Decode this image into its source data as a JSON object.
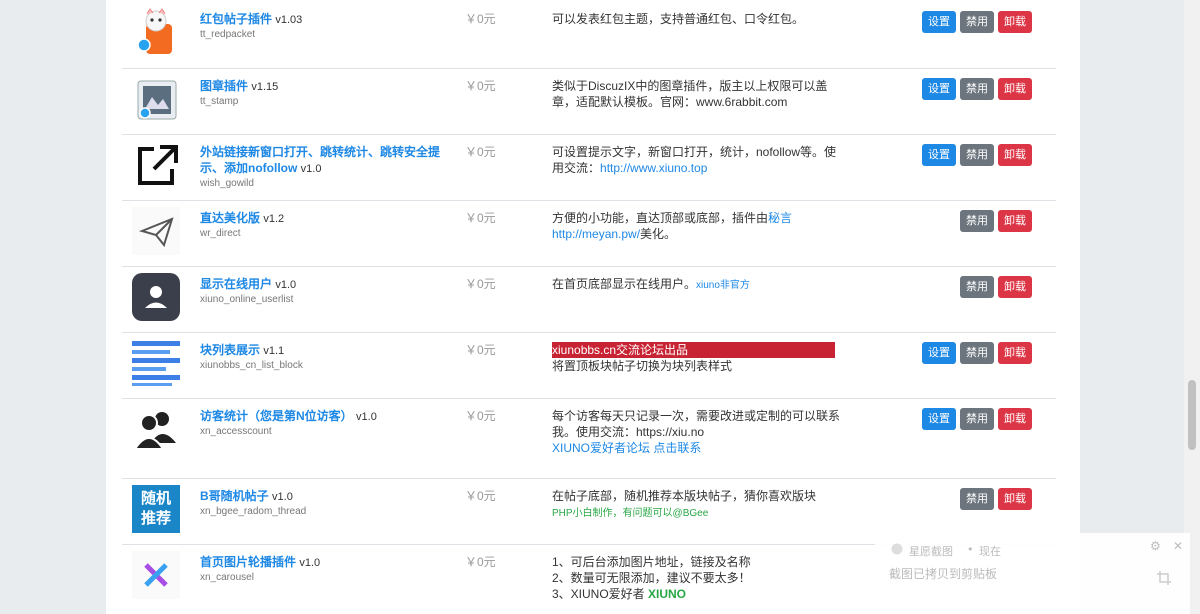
{
  "plugins": [
    {
      "name": "红包帖子插件",
      "version": "v1.03",
      "id": "tt_redpacket",
      "price": "￥0元",
      "desc": [
        {
          "t": "可以发表红包主题，支持普通红包、口令红包。"
        }
      ],
      "buttons": [
        "设置",
        "禁用",
        "卸载"
      ]
    },
    {
      "name": "图章插件",
      "version": "v1.15",
      "id": "tt_stamp",
      "price": "￥0元",
      "desc": [
        {
          "t": "类似于DiscuzIX中的图章插件，版主以上权限可以盖章，适配默认模板。官网：www.6rabbit.com"
        }
      ],
      "buttons": [
        "设置",
        "禁用",
        "卸载"
      ]
    },
    {
      "name": "外站链接新窗口打开、跳转统计、跳转安全提示、添加nofollow",
      "version": "v1.0",
      "id": "wish_gowild",
      "price": "￥0元",
      "desc": [
        {
          "t": "可设置提示文字，新窗口打开，统计，nofollow等。使用交流："
        },
        {
          "t": "http://www.xiuno.top",
          "c": "link"
        }
      ],
      "buttons": [
        "设置",
        "禁用",
        "卸载"
      ]
    },
    {
      "name": "直达美化版",
      "version": "v1.2",
      "id": "wr_direct",
      "price": "￥0元",
      "desc": [
        {
          "t": "方便的小功能，直达顶部或底部，插件由"
        },
        {
          "t": "秘言",
          "c": "link"
        },
        {
          "t": " "
        },
        {
          "t": "http://meyan.pw/",
          "c": "link"
        },
        {
          "t": "美化。"
        }
      ],
      "buttons": [
        "禁用",
        "卸载"
      ]
    },
    {
      "name": "显示在线用户",
      "version": "v1.0",
      "id": "xiuno_online_userlist",
      "price": "￥0元",
      "desc": [
        {
          "t": "在首页底部显示在线用户。"
        },
        {
          "t": "xiuno非官方",
          "c": "small-blue"
        }
      ],
      "buttons": [
        "禁用",
        "卸载"
      ]
    },
    {
      "name": "块列表展示",
      "version": "v1.1",
      "id": "xiunobbs_cn_list_block",
      "price": "￥0元",
      "desc": [
        {
          "t": "xiunobbs.cn交流论坛出品",
          "c": "highlight"
        },
        {
          "t": "将置顶板块帖子切换为块列表样式"
        }
      ],
      "buttons": [
        "设置",
        "禁用",
        "卸载"
      ]
    },
    {
      "name": "访客统计（您是第N位访客）",
      "version": "v1.0",
      "id": "xn_accesscount",
      "price": "￥0元",
      "desc": [
        {
          "t": "每个访客每天只记录一次，需要改进或定制的可以联系我。使用交流：https://xiu.no"
        },
        {
          "t": "\n"
        },
        {
          "t": "XIUNO爱好者论坛  点击联系",
          "c": "link"
        }
      ],
      "buttons": [
        "设置",
        "禁用",
        "卸载"
      ]
    },
    {
      "name": "B哥随机帖子",
      "version": "v1.0",
      "id": "xn_bgee_radom_thread",
      "price": "￥0元",
      "desc": [
        {
          "t": "在帖子底部，随机推荐本版块帖子，猜你喜欢版块"
        },
        {
          "t": "\n"
        },
        {
          "t": "PHP小白制作，有问题可以@BGee",
          "c": "green"
        }
      ],
      "buttons": [
        "禁用",
        "卸载"
      ]
    },
    {
      "name": "首页图片轮播插件",
      "version": "v1.0",
      "id": "xn_carousel",
      "price": "￥0元",
      "desc": [
        {
          "t": "1、可后台添加图片地址，链接及名称"
        },
        {
          "t": "\n"
        },
        {
          "t": "2、数量可无限添加，建议不要太多！"
        },
        {
          "t": "\n"
        },
        {
          "t": "3、XIUNO爱好者  "
        },
        {
          "t": "XIUNO",
          "c": "bold-green"
        }
      ],
      "buttons": []
    }
  ],
  "icon_text": {
    "random_line1": "随机",
    "random_line2": "推荐"
  },
  "toast": {
    "app": "星愿截图",
    "dot": "•",
    "time": "现在",
    "message": "截图已拷贝到剪贴板"
  },
  "colors": {
    "link": "#1e88e5",
    "set": "#1e88e5",
    "disable": "#6c757d",
    "uninstall": "#dc3545",
    "highlight": "#c82333"
  }
}
